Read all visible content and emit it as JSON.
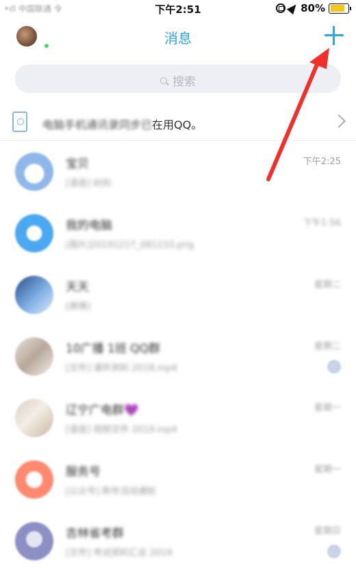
{
  "status_bar": {
    "carrier": "•ıll 中国联通 令",
    "time": "下午2:51",
    "battery_percent_label": "80%",
    "battery_level": 0.8,
    "battery_color": "#f5c518"
  },
  "nav": {
    "title": "消息",
    "accent_color": "#2ea7e0"
  },
  "search": {
    "placeholder": "搜索"
  },
  "banner": {
    "blurred_text": "电脑手机通讯录同步已",
    "text": "在用QQ。"
  },
  "conversations": [
    {
      "avatar": "avatar-a",
      "name": "宝贝",
      "preview": "[语音] 好的",
      "time": "下午2:25"
    },
    {
      "avatar": "avatar-b",
      "name": "我的电脑",
      "preview": "[图片]20191217_081233.png",
      "time": "下午1:56"
    },
    {
      "avatar": "avatar-c",
      "name": "天天",
      "preview": "[表情]",
      "time": "星期二"
    },
    {
      "avatar": "avatar-d",
      "name": "10广播 1班 QQ群",
      "preview": "[文件] 课件资料 2018.mp4",
      "time": "星期二"
    },
    {
      "avatar": "avatar-e",
      "name": "辽宁广电群💜",
      "preview": "[语音] 视频文件 2019.mp4",
      "time": "星期一"
    },
    {
      "avatar": "avatar-f",
      "name": "服务号",
      "preview": "[公众号] 新年活动通知",
      "time": "星期一"
    },
    {
      "avatar": "avatar-g",
      "name": "吉林省考群",
      "preview": "[文件] 考试资料汇总 2019",
      "time": "星期日"
    }
  ]
}
